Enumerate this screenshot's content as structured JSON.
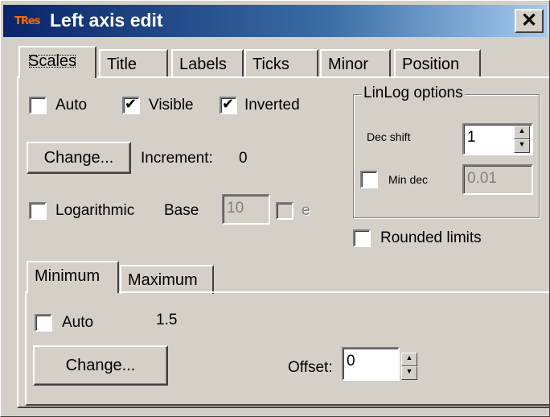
{
  "window": {
    "title": "Left axis edit",
    "app_icon_text": "TRes",
    "close_label": "✕"
  },
  "tabs": [
    {
      "label": "Scales"
    },
    {
      "label": "Title"
    },
    {
      "label": "Labels"
    },
    {
      "label": "Ticks"
    },
    {
      "label": "Minor"
    },
    {
      "label": "Position"
    }
  ],
  "scales": {
    "auto_label": "Auto",
    "auto_checked": false,
    "visible_label": "Visible",
    "visible_checked": true,
    "inverted_label": "Inverted",
    "inverted_checked": true,
    "change_label": "Change...",
    "increment_label": "Increment:",
    "increment_value": "0",
    "logarithmic_label": "Logarithmic",
    "base_label": "Base",
    "base_value": "10",
    "e_label": "e",
    "linlog": {
      "group_title": "LinLog options",
      "dec_shift_label": "Dec shift",
      "dec_shift_value": "1",
      "min_dec_label": "Min dec",
      "min_dec_value": "0.01"
    },
    "rounded_limits_label": "Rounded limits"
  },
  "sub_tabs": [
    {
      "label": "Minimum"
    },
    {
      "label": "Maximum"
    }
  ],
  "minimum": {
    "auto_label": "Auto",
    "auto_value": "1.5",
    "change_label": "Change...",
    "offset_label": "Offset:",
    "offset_value": "0"
  }
}
